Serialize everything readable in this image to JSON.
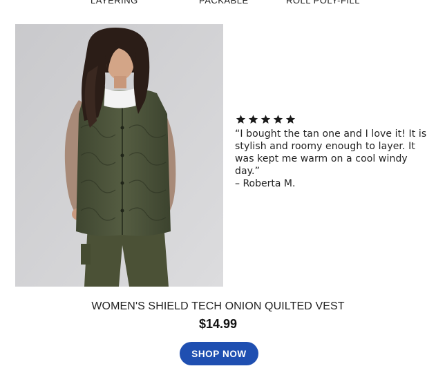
{
  "features": {
    "items": [
      "LAYERING",
      "PACKABLE",
      "ROLL POLY-FILL"
    ]
  },
  "review": {
    "rating": 5,
    "quote": "“I bought the tan one and I love it! It is stylish and roomy enough to layer. It was kept me warm on a cool windy day.”",
    "author": "– Roberta M."
  },
  "product": {
    "name": "WOMEN'S SHIELD TECH ONION QUILTED VEST",
    "price": "$14.99",
    "cta_label": "SHOP NOW"
  },
  "colors": {
    "cta": "#1f4fb1",
    "vest": "#4a5138",
    "background": "#ffffff"
  },
  "icons": [
    "star-icon"
  ]
}
